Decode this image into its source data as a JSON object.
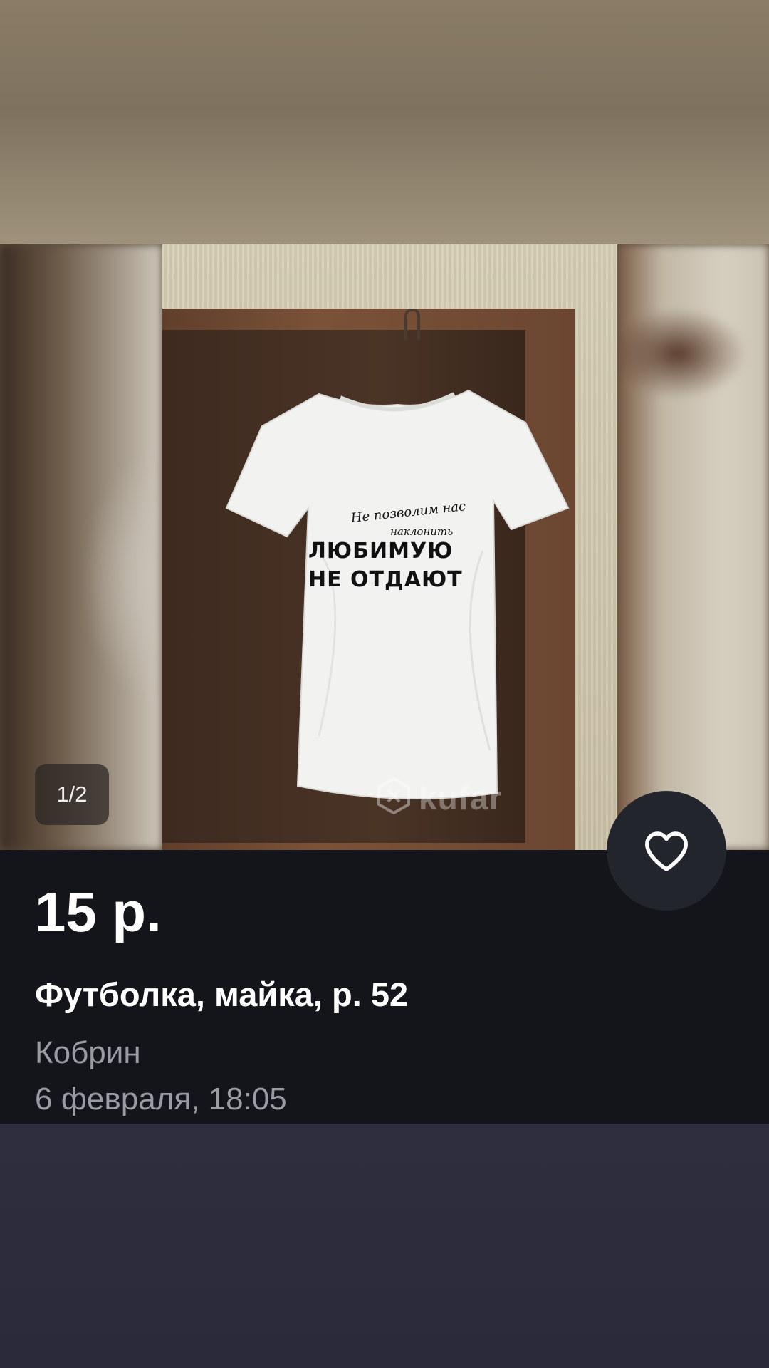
{
  "gallery": {
    "counter": "1/2",
    "watermark": "kufar",
    "shirt_print": {
      "script_line_1": "Не позволим нас",
      "script_line_2": "наклонить",
      "big_line_1": "ЛЮБИМУЮ",
      "big_line_2": "НЕ ОТДАЮТ"
    }
  },
  "listing": {
    "price": "15 р.",
    "title": "Футболка, майка, р. 52",
    "location": "Кобрин",
    "date": "6 февраля, 18:05"
  },
  "favorite": {
    "icon": "heart-outline-icon"
  },
  "colors": {
    "panel_bg": "#13151b",
    "text_primary": "#ffffff",
    "text_secondary": "#9b9ca3",
    "fav_button_bg": "#22252c"
  }
}
